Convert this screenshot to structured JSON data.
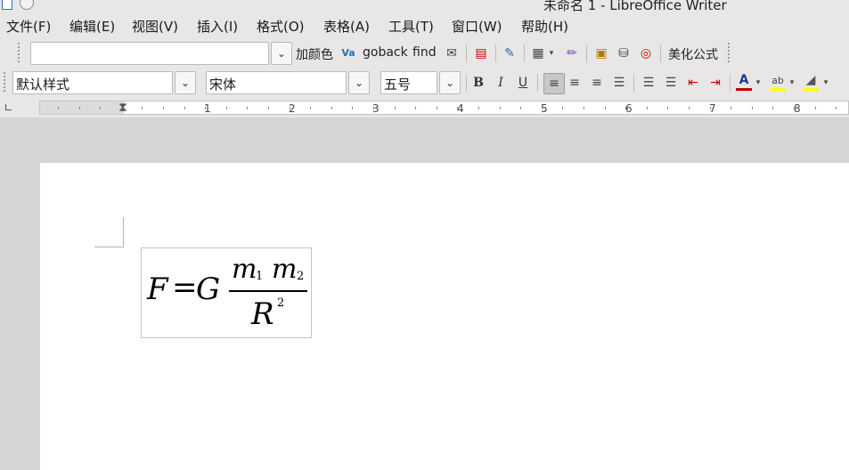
{
  "window": {
    "title": "未命名 1 - LibreOffice Writer"
  },
  "menu": {
    "items": [
      "文件(F)",
      "编辑(E)",
      "视图(V)",
      "插入(I)",
      "格式(O)",
      "表格(A)",
      "工具(T)",
      "窗口(W)",
      "帮助(H)"
    ]
  },
  "toolbar1": {
    "combo_value": "",
    "macro_buttons": {
      "add_color": "加颜色",
      "goback": "goback",
      "find": "find",
      "beautify": "美化公式"
    }
  },
  "toolbar2": {
    "paragraph_style": "默认样式",
    "font_name": "宋体",
    "font_size": "五号",
    "bold": "B",
    "italic": "I",
    "underline": "U"
  },
  "ruler": {
    "numbers": [
      "1",
      "2",
      "3",
      "4",
      "5",
      "6",
      "7",
      "8"
    ]
  },
  "formula": {
    "lhs": "F",
    "eq": "=",
    "const": "G",
    "num1": "m",
    "sub1": "1",
    "num2": "m",
    "sub2": "2",
    "den": "R",
    "exp": "2"
  },
  "colors": {
    "font_color": "#c00000",
    "highlight": "#ffff00",
    "bg_color": "#ffff00"
  }
}
